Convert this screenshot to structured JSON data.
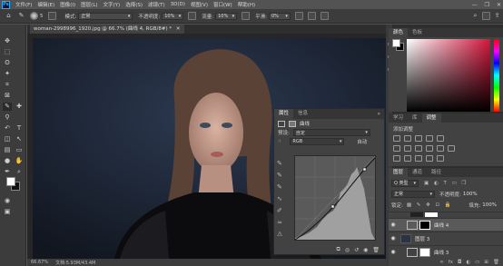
{
  "app": {
    "logo": "Ps"
  },
  "menu": [
    "文件(F)",
    "编辑(E)",
    "图像(I)",
    "图层(L)",
    "文字(Y)",
    "选择(S)",
    "滤镜(T)",
    "3D(D)",
    "视图(V)",
    "窗口(W)",
    "帮助(H)"
  ],
  "window_controls": [
    "—",
    "❐",
    "✕"
  ],
  "options_bar": {
    "brush_size": "5",
    "mode_label": "模式:",
    "mode_value": "正常",
    "opacity_label": "不透明度:",
    "opacity_value": "10%",
    "flow_label": "流量:",
    "flow_value": "10%",
    "smoothing_label": "平滑:",
    "smoothing_value": "0%"
  },
  "document": {
    "tab_title": "woman-2998996_1920.jpg @ 66.7% (曲线 4, RGB/8#) *",
    "zoom": "66.67%",
    "doc_info": "文档:5.93M/43.4M"
  },
  "properties": {
    "tabs": [
      "属性",
      "信息"
    ],
    "title": "曲线",
    "preset_label": "预设:",
    "preset_value": "自定",
    "channel_value": "RGB",
    "auto_label": "自动"
  },
  "color_panel": {
    "tabs": [
      "颜色",
      "色板"
    ]
  },
  "adjust_panel": {
    "tabs": [
      "学习",
      "库",
      "调整"
    ],
    "add_label": "添加调整"
  },
  "layers_panel": {
    "tabs": [
      "图层",
      "通道",
      "路径"
    ],
    "filter_label": "Q 类型",
    "blend_mode": "正常",
    "opacity_label": "不透明度:",
    "opacity_value": "100%",
    "lock_label": "锁定:",
    "fill_label": "填充:",
    "fill_value": "100%",
    "layers": [
      {
        "name": "曲线 4"
      },
      {
        "name": "图层 3"
      },
      {
        "name": "曲线 3"
      }
    ]
  },
  "colors": {
    "accent": "#31a8ff",
    "panel": "#424242",
    "toolbar": "#3c3c3c"
  }
}
